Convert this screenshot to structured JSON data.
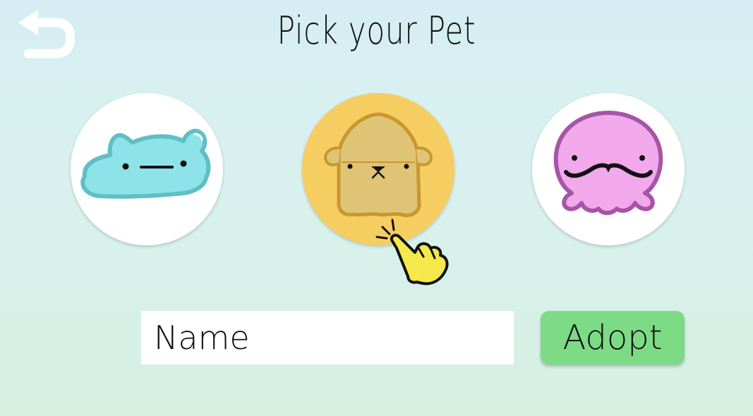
{
  "header": {
    "title": "Pick your Pet",
    "back_icon": "undo-arrow-icon"
  },
  "pets": [
    {
      "id": "blob",
      "creature": "blue-blob-icon",
      "selected": false,
      "color": "#8de3e8"
    },
    {
      "id": "dog",
      "creature": "tan-dog-icon",
      "selected": true,
      "color": "#e0c475"
    },
    {
      "id": "octo",
      "creature": "pink-octopus-icon",
      "selected": false,
      "color": "#f2a9ec"
    }
  ],
  "pointer": {
    "icon": "pointing-hand-icon",
    "color": "#f5e84a"
  },
  "form": {
    "name_placeholder": "Name",
    "name_value": "",
    "adopt_label": "Adopt"
  },
  "colors": {
    "selected_circle": "#f6cd60",
    "adopt_button": "#7ddb85",
    "background_top": "#d6eef3",
    "background_bottom": "#d6f0e2"
  }
}
